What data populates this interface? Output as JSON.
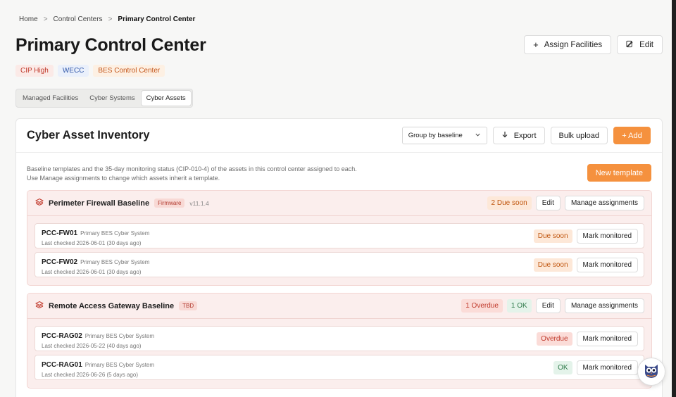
{
  "breadcrumb": {
    "items": [
      "Home",
      "Control Centers"
    ],
    "current": "Primary Control Center",
    "sep": ">"
  },
  "page": {
    "title": "Primary Control Center"
  },
  "header": {
    "assign_label": "Assign Facilities",
    "edit_label": "Edit"
  },
  "tags": [
    {
      "label": "CIP High",
      "color": "#c0392b"
    },
    {
      "label": "WECC",
      "color": "#2e55a8"
    },
    {
      "label": "BES Control Center",
      "color": "#c4561a"
    }
  ],
  "tabs": [
    {
      "label": "Managed Facilities"
    },
    {
      "label": "Cyber Systems"
    },
    {
      "label": "Cyber Assets",
      "active": true
    }
  ],
  "inventory": {
    "title": "Cyber Asset Inventory",
    "group_by": "Group by baseline",
    "export_label": "Export",
    "bulk_label": "Bulk upload",
    "add_label": "+ Add",
    "desc_line1": "Baseline templates and the 35-day monitoring status (CIP-010-4) of the assets in this control center assigned to each.",
    "desc_line2": "Use Manage assignments to change which assets inherit a template.",
    "new_template_label": "New template"
  },
  "groups": [
    {
      "name": "Perimeter Firewall Baseline",
      "badge": "Firmware",
      "version": "v11.1.4",
      "due_label": "2 Due soon",
      "edit_label": "Edit",
      "manage_label": "Manage assignments",
      "assets": [
        {
          "id": "PCC-FW01",
          "type": "Primary BES Cyber System",
          "meta": "Last checked 2026-06-01 (30 days ago)",
          "status": "Due soon",
          "action": "Mark monitored"
        },
        {
          "id": "PCC-FW02",
          "type": "Primary BES Cyber System",
          "meta": "Last checked 2026-06-01 (30 days ago)",
          "status": "Due soon",
          "action": "Mark monitored"
        }
      ]
    },
    {
      "name": "Remote Access Gateway Baseline",
      "badge": "TBD",
      "overdue_label": "1 Overdue",
      "ok_label": "1 OK",
      "edit_label": "Edit",
      "manage_label": "Manage assignments",
      "assets": [
        {
          "id": "PCC-RAG02",
          "type": "Primary BES Cyber System",
          "meta": "Last checked 2026-05-22 (40 days ago)",
          "status": "Overdue",
          "action": "Mark monitored"
        },
        {
          "id": "PCC-RAG01",
          "type": "Primary BES Cyber System",
          "meta": "Last checked 2026-06-26 (5 days ago)",
          "status": "OK",
          "action": "Mark monitored"
        }
      ]
    }
  ],
  "icons": {
    "plus": "plus-icon",
    "edit": "edit-icon",
    "chevron": "chevron-down-icon",
    "download": "download-icon",
    "layers": "layers-icon",
    "assistant": "owl-assistant-icon"
  }
}
